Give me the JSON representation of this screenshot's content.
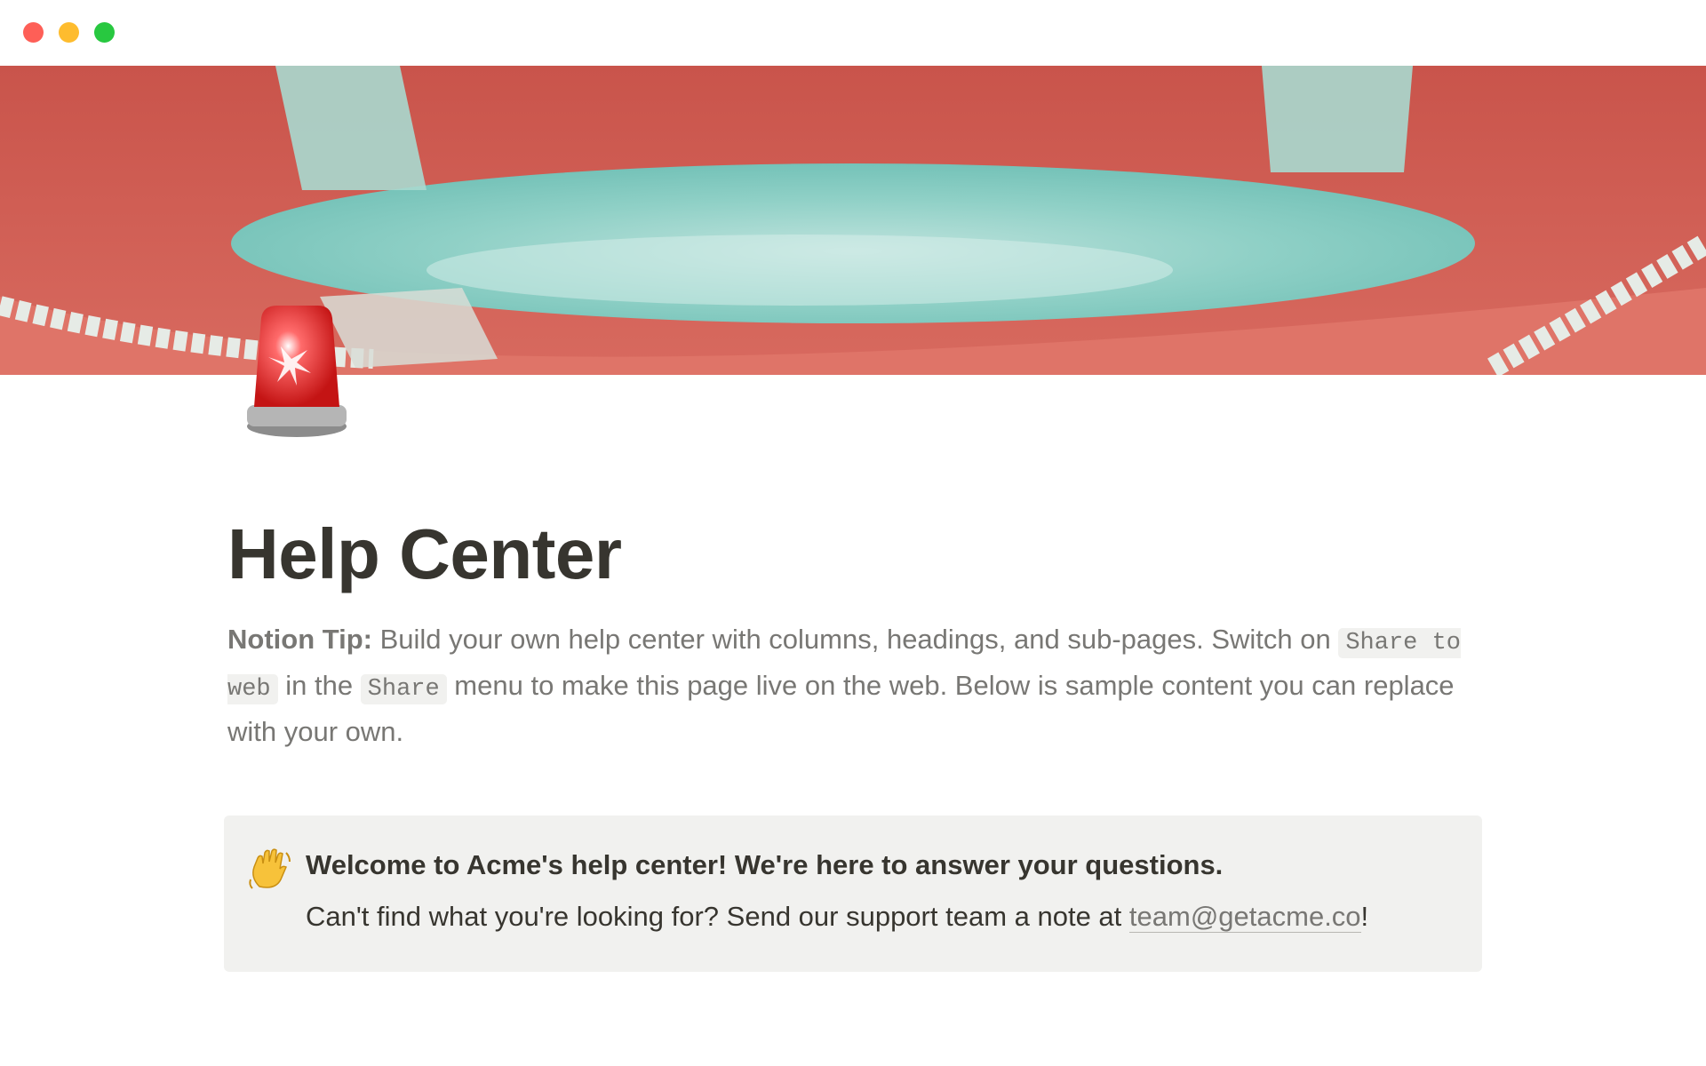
{
  "window": {
    "controls": [
      "close",
      "minimize",
      "maximize"
    ]
  },
  "cover": {
    "image": "life-ring-cover"
  },
  "page": {
    "icon": "police-light-emoji",
    "title": "Help Center"
  },
  "tip": {
    "label": "Notion Tip:",
    "text_1": " Build your own help center with columns, headings, and sub-pages. Switch on ",
    "code_1": "Share to web",
    "text_2": " in the ",
    "code_2": "Share",
    "text_3": " menu to make this page live on the web. Below is sample content you can replace with your own."
  },
  "callout": {
    "icon": "waving-hand-emoji",
    "heading": "Welcome to Acme's help center! We're here to answer your questions.",
    "body_prefix": "Can't find what you're looking for? Send our support team a note at ",
    "email": "team@getacme.co",
    "body_suffix": "!"
  },
  "colors": {
    "text": "#37352f",
    "muted_text": "#787774",
    "callout_bg": "#f1f1ef",
    "code_bg": "#f1f1ef"
  }
}
